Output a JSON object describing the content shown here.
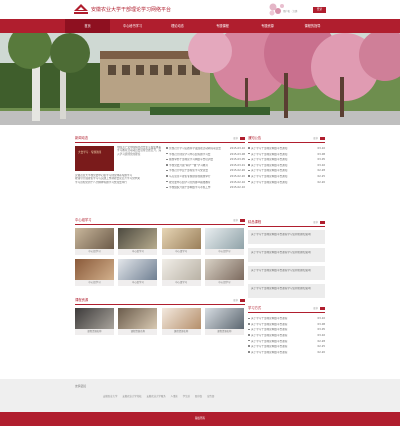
{
  "header": {
    "site_title": "安徽农业大学干部理论学习网络平台",
    "user_links": "用户名 · 注销",
    "login_label": "登录"
  },
  "nav": [
    "首页",
    "中心秘书学习",
    "理论动态",
    "专题课程",
    "专题资源",
    "课程的指导"
  ],
  "banner": {
    "alt": ""
  },
  "news": {
    "title": "新闻动态",
    "more": "更多",
    "image_caption": "大会学习 · 专题讲座",
    "intro": "中国共产党中国特色社会主义理论体系学习教育活动动员会议在合肥召开，深入学习贯彻党的理论",
    "extra_lines": [
      "安徽农业大学校党委中心组学习理论体系专题学习",
      "校领导开展理论学习与实践工作调研会议召开学习党中央",
      "学习贯彻党的十八大精神专题学习交流会举行"
    ],
    "items": [
      {
        "text": "党校召开学习实践科学发展观活动转段动员会",
        "date": "2015-03-10"
      },
      {
        "text": "学校召开理论学习中心组专题学习会",
        "date": "2015-03-08"
      },
      {
        "text": "我校举办干部理论学习网络平台培训会",
        "date": "2015-03-05"
      },
      {
        "text": "学校党委开展“两学一做”学习教育",
        "date": "2015-03-01"
      },
      {
        "text": "学校召开中层干部理论学习交流会",
        "date": "2015-02-26"
      },
      {
        "text": "马克思主义理论专题讲座在我校举行",
        "date": "2015-02-20"
      },
      {
        "text": "校党委中心组学习党的群众路线教育",
        "date": "2015-02-16"
      },
      {
        "text": "学校组织开展干部网络学习考核工作",
        "date": "2015-02-10"
      }
    ]
  },
  "notice": {
    "title": "通知公告",
    "more": "更多",
    "items": [
      {
        "text": "关于学习干部理论网络平台通知",
        "date": "03-10"
      },
      {
        "text": "关于学习干部理论网络平台通知",
        "date": "03-08"
      },
      {
        "text": "关于学习干部理论网络平台通知",
        "date": "03-05"
      },
      {
        "text": "关于学习干部理论网络平台通知",
        "date": "03-02"
      },
      {
        "text": "关于学习干部理论网络平台通知",
        "date": "02-28"
      },
      {
        "text": "关于学习干部理论网络平台通知",
        "date": "02-25"
      },
      {
        "text": "关于学习干部理论网络平台通知",
        "date": "02-20"
      }
    ]
  },
  "center": {
    "title": "中心组学习",
    "more": "更多",
    "tiles": [
      "中心组学习",
      "中心组学习",
      "中心组学习",
      "中心组学习",
      "中心组学习",
      "中心组学习",
      "中心组学习",
      "中心组学习"
    ]
  },
  "ranking": {
    "title": "精品课程",
    "more": "更多",
    "items": [
      "关于学习干部理论网络平台课程学习安排的通知说明",
      "关于学习干部理论网络平台课程学习安排的通知说明",
      "关于学习干部理论网络平台课程学习安排的通知说明",
      "关于学习干部理论网络平台课程学习安排的通知说明"
    ]
  },
  "courses": {
    "title": "课程资源",
    "more": "更多",
    "tiles": [
      "课程资源名称",
      "课程资源名称",
      "课程资源名称",
      "课程资源名称"
    ]
  },
  "study": {
    "title": "学习方式",
    "more": "更多",
    "items": [
      {
        "text": "关于学习干部理论网络平台课程",
        "date": "03-10"
      },
      {
        "text": "关于学习干部理论网络平台课程",
        "date": "03-08"
      },
      {
        "text": "关于学习干部理论网络平台课程",
        "date": "03-05"
      },
      {
        "text": "关于学习干部理论网络平台课程",
        "date": "03-02"
      },
      {
        "text": "关于学习干部理论网络平台课程",
        "date": "02-28"
      },
      {
        "text": "关于学习干部理论网络平台课程",
        "date": "02-25"
      },
      {
        "text": "关于学习干部理论网络平台课程",
        "date": "02-20"
      }
    ]
  },
  "footer": {
    "label": "友情链接",
    "links": [
      "安徽农业大学",
      "安徽农业大学党校",
      "安徽农业大学教务",
      "人事处",
      "学生处",
      "图书馆",
      "宣传部"
    ],
    "copyright": "版权所有"
  },
  "colors": {
    "primary": "#b01e2e",
    "primary_dark": "#8e1020"
  }
}
